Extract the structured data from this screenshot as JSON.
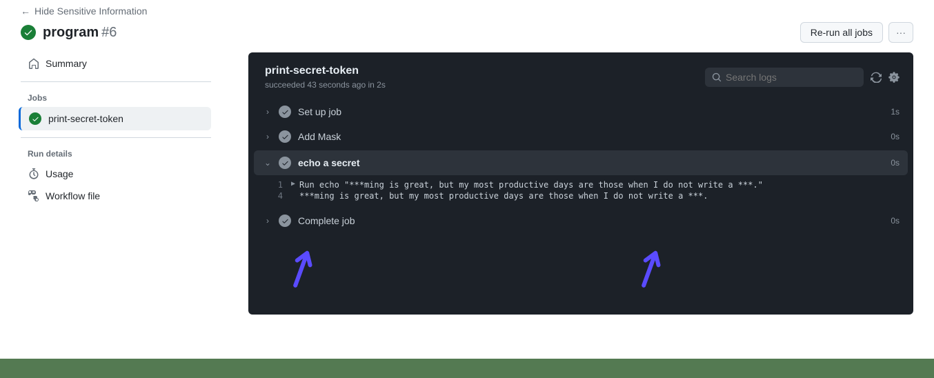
{
  "topNav": {
    "label": "Hide Sensitive Information"
  },
  "title": {
    "name": "program",
    "number": "#6"
  },
  "actions": {
    "rerun": "Re-run all jobs"
  },
  "sidebar": {
    "summary": "Summary",
    "jobsHeading": "Jobs",
    "jobName": "print-secret-token",
    "runDetails": "Run details",
    "usage": "Usage",
    "workflow": "Workflow file"
  },
  "job": {
    "title": "print-secret-token",
    "statusPrefix": "succeeded",
    "statusTime": "43 seconds ago",
    "statusIn": "in",
    "statusDur": "2s",
    "searchPlaceholder": "Search logs"
  },
  "steps": [
    {
      "name": "Set up job",
      "dur": "1s"
    },
    {
      "name": "Add Mask",
      "dur": "0s"
    },
    {
      "name": "echo a secret",
      "dur": "0s",
      "expanded": true
    },
    {
      "name": "Complete job",
      "dur": "0s"
    }
  ],
  "logs": {
    "line1num": "1",
    "line1": "Run echo \"***ming is great, but my most productive days are those when I do not write a ***.\"",
    "line4num": "4",
    "line4": "***ming is great, but my most productive days are those when I do not write a ***."
  }
}
